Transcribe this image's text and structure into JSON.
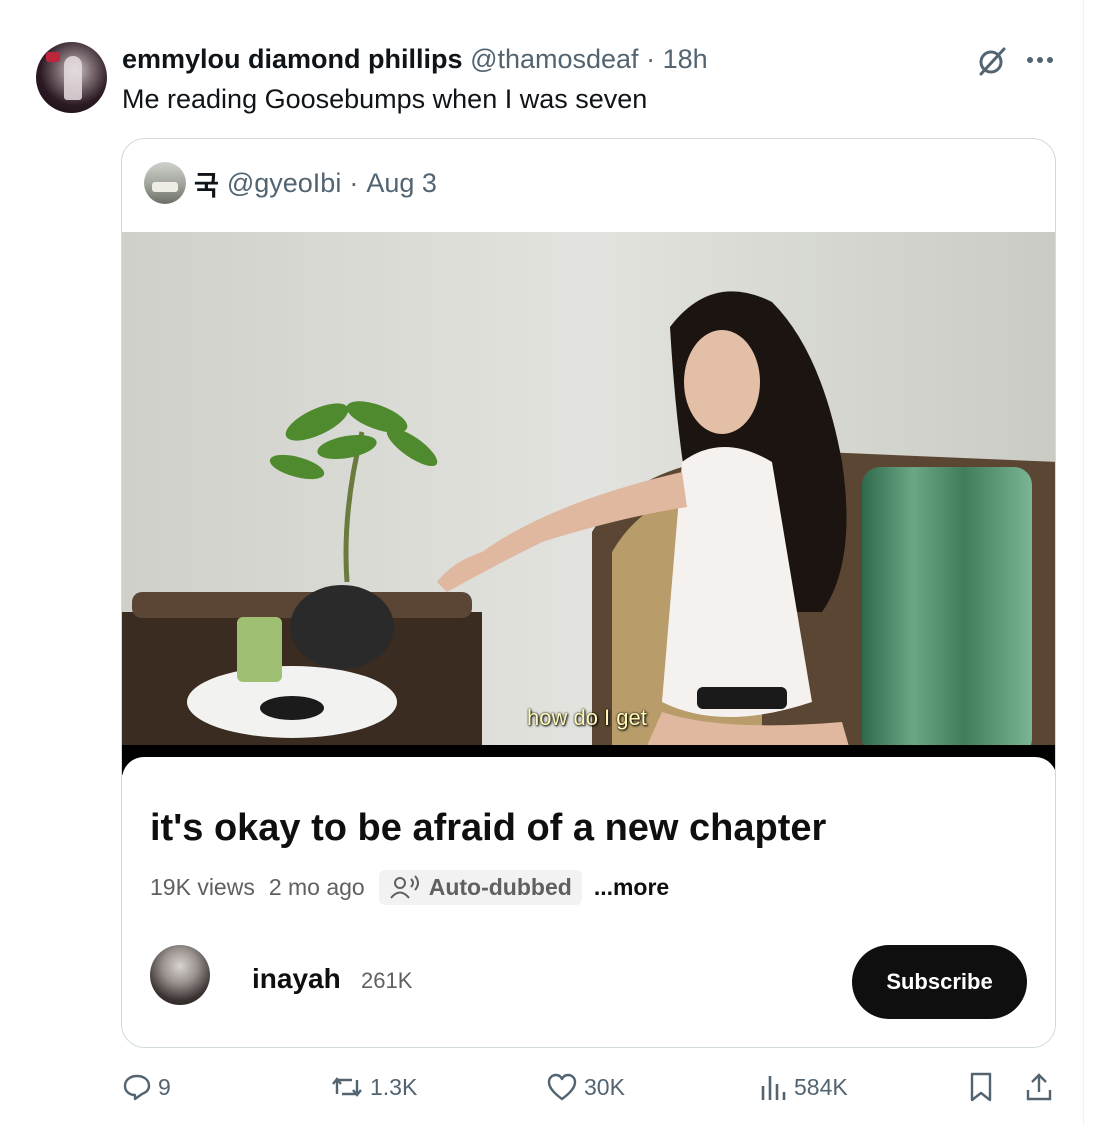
{
  "tweet": {
    "author_name": "emmylou diamond phillips",
    "handle": "@thamosdeaf",
    "separator": "·",
    "time": "18h",
    "text": "Me reading Goosebumps when I was seven"
  },
  "quote": {
    "name": "국",
    "handle": "@gyeoIbi",
    "separator": "·",
    "date": "Aug 3",
    "video_caption": "how do I get",
    "progress_fraction": 0.01
  },
  "youtube": {
    "title": "it's okay to be afraid of a new chapter",
    "views": "19K views",
    "age": "2 mo ago",
    "auto_dubbed": "Auto-dubbed",
    "more": "...more",
    "channel_name": "inayah",
    "subscriber_count": "261K",
    "subscribe_label": "Subscribe"
  },
  "actions": {
    "replies": "9",
    "reposts": "1.3K",
    "likes": "30K",
    "views": "584K"
  },
  "icons": {
    "grok": "grok-slash-icon",
    "more": "more-dots-icon",
    "reply": "reply-bubble-icon",
    "repost": "repost-arrows-icon",
    "like": "heart-icon",
    "views": "bar-chart-icon",
    "bookmark": "bookmark-icon",
    "share": "share-upload-icon"
  },
  "colors": {
    "text_primary": "#0f1419",
    "text_muted": "#536471",
    "border": "#cfd9de",
    "subscribe_bg": "#0f0f0f",
    "progress_red": "#e32424"
  }
}
